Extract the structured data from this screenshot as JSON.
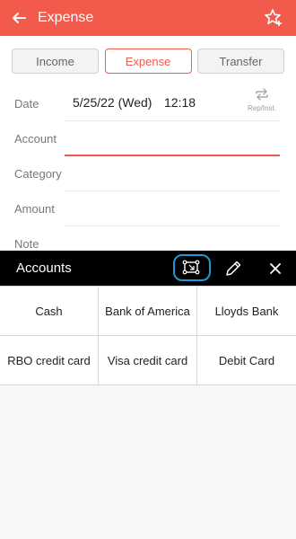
{
  "header": {
    "title": "Expense",
    "icons": {
      "back": "arrow-left-icon",
      "favorite": "star-plus-icon"
    }
  },
  "type_tabs": [
    {
      "label": "Income",
      "active": false
    },
    {
      "label": "Expense",
      "active": true
    },
    {
      "label": "Transfer",
      "active": false
    }
  ],
  "form": {
    "date_label": "Date",
    "date_value": "5/25/22 (Wed)",
    "time_value": "12:18",
    "repeat_label": "Rep/Inst.",
    "account_label": "Account",
    "account_value": "",
    "category_label": "Category",
    "amount_label": "Amount",
    "note_label": "Note"
  },
  "picker": {
    "title": "Accounts",
    "icons": {
      "arrange": "arrange-icon",
      "edit": "pencil-icon",
      "close": "close-icon"
    },
    "accounts": [
      "Cash",
      "Bank of America",
      "Lloyds Bank",
      "RBO credit card",
      "Visa credit card",
      "Debit Card"
    ]
  },
  "colors": {
    "accent": "#f25a4b",
    "focus_ring": "#1e9ad6",
    "picker_bar": "#000000"
  }
}
